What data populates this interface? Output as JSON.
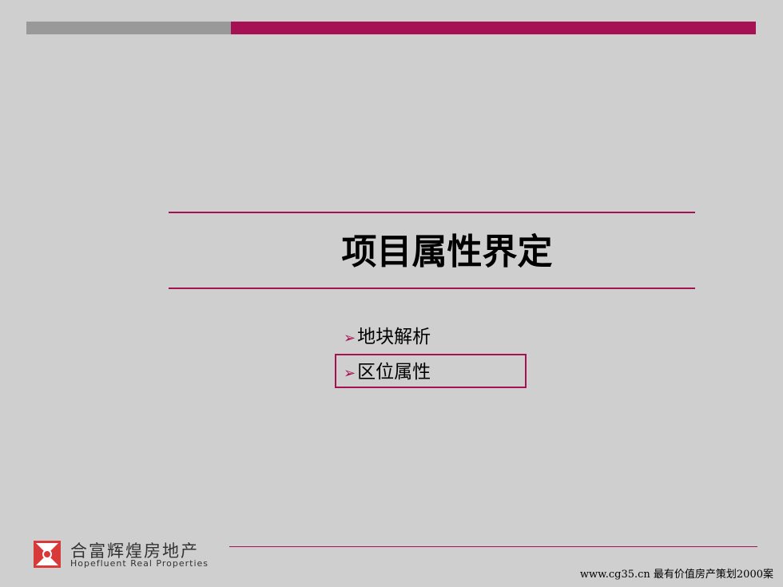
{
  "colors": {
    "accent": "#a51152",
    "gray_bar": "#999999",
    "background": "#cfcfcf"
  },
  "slide": {
    "title": "项目属性界定",
    "items": [
      {
        "bullet": "➢",
        "label": "地块解析"
      },
      {
        "bullet": "➢",
        "label": "区位属性"
      }
    ]
  },
  "logo": {
    "icon": "company-logo-icon",
    "name_cn": "合富辉煌房地产",
    "name_en": "Hopefluent Real Properties"
  },
  "footer": {
    "text": "www.cg35.cn 最有价值房产策划2000案"
  }
}
